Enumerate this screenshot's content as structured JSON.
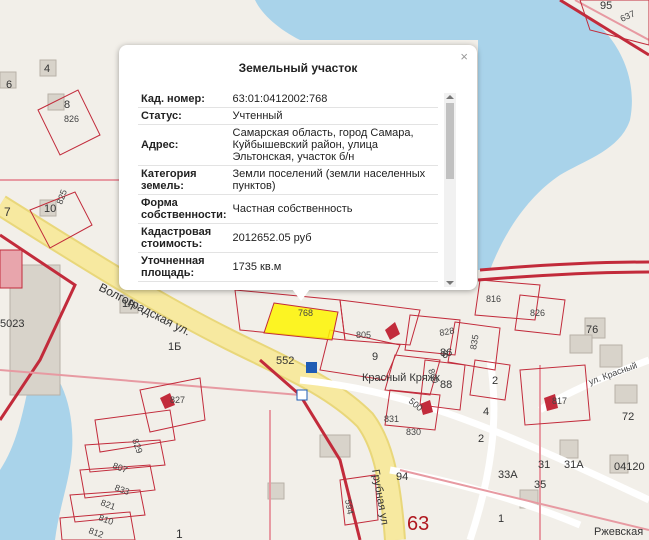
{
  "popup": {
    "title": "Земельный участок",
    "close_icon": "×",
    "rows": [
      {
        "key": "Кад. номер:",
        "value": "63:01:0412002:768"
      },
      {
        "key": "Статус:",
        "value": "Учтенный"
      },
      {
        "key": "Адрес:",
        "value": "Самарская область, город Самара, Куйбышевский район, улица Эльтонская, участок б/н"
      },
      {
        "key": "Категория земель:",
        "value": "Земли поселений (земли населенных пунктов)"
      },
      {
        "key": "Форма собственности:",
        "value": "Частная собственность"
      },
      {
        "key": "Кадастровая стоимость:",
        "value": "2012652.05 руб"
      },
      {
        "key": "Уточненная площадь:",
        "value": "1735 кв.м"
      }
    ]
  },
  "map": {
    "streets": {
      "volgogradskaya": "Волгоградская ул.",
      "krasny_kryazh": "Красный Кряжк",
      "krasny_kryazh_2": "ул. Красный",
      "rzhevskaya": "Ржевская",
      "gubnaya": "Грубная ул"
    },
    "parcel_labels": {
      "main": "768",
      "p552": "552",
      "p5023": "5023",
      "p826": "826",
      "p825": "825",
      "p827": "827",
      "p829": "829",
      "p807": "807",
      "p833": "833",
      "p816": "816",
      "p826b": "826",
      "p828": "828",
      "p835": "835",
      "p805": "805",
      "p831": "831",
      "p830": "830",
      "p800": "800",
      "p500": "500",
      "p817": "817",
      "p821": "821",
      "p810": "810",
      "p812": "812",
      "p637": "637",
      "p594": "594"
    },
    "house_numbers": [
      "6",
      "4",
      "8",
      "7",
      "10",
      "1А",
      "1Б",
      "9",
      "6",
      "2",
      "76",
      "72",
      "4",
      "2",
      "31",
      "31А",
      "33А",
      "35",
      "94",
      "1",
      "95",
      "1",
      "86",
      "88"
    ],
    "block_number": "63",
    "quarter_number": "04120",
    "colors": {
      "water": "#a9d3ea",
      "parcel_line": "#c22b3b",
      "selected_parcel": "#fef500",
      "building": "#d0cbc2",
      "road_main": "#f7e9a0",
      "bg": "#f2efe9"
    }
  }
}
